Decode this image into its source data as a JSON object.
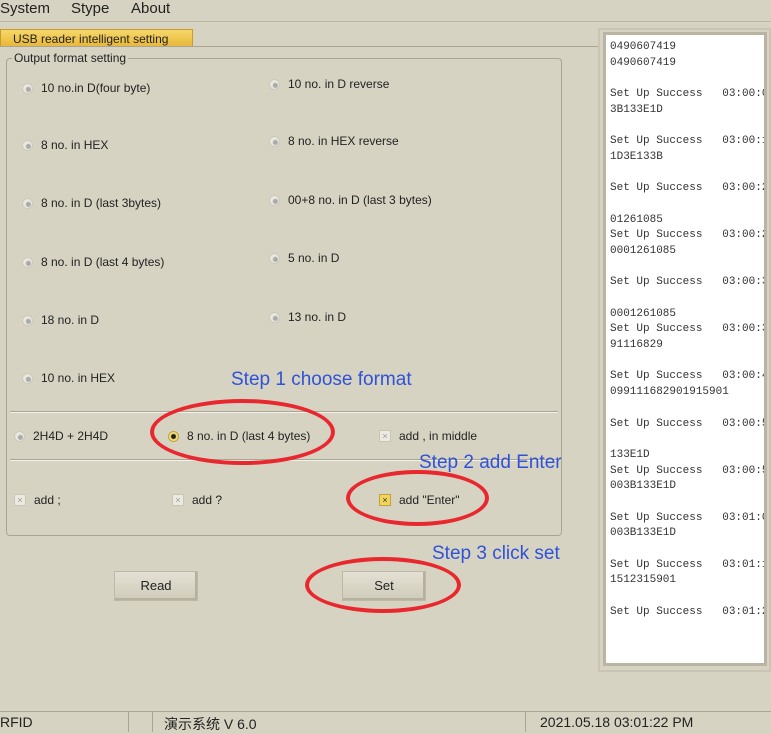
{
  "menu": {
    "system": "System",
    "stype": "Stype",
    "about": "About"
  },
  "tab": "USB reader intelligent setting",
  "group_label": "Output format setting",
  "formats": [
    "10 no.in D(four byte)",
    "10 no. in D reverse",
    "8 no. in HEX",
    "8 no. in HEX reverse",
    "8 no. in D (last 3bytes)",
    "00+8 no. in D (last 3 bytes)",
    "8 no. in D (last 4 bytes)",
    "5 no. in D",
    "18 no. in D",
    "13 no. in D",
    "10 no. in HEX"
  ],
  "row2": {
    "r1": "2H4D + 2H4D",
    "r2": "8 no. in D (last 4 bytes)",
    "r2_selected": true,
    "c1": "add , in middle"
  },
  "row3": {
    "c1": "add ;",
    "c2": "add ?",
    "c3": "add \"Enter\"",
    "c3_checked": true
  },
  "buttons": {
    "read": "Read",
    "set": "Set"
  },
  "annotations": {
    "step1": "Step 1 choose format",
    "step2": "Step 2 add Enter",
    "step3": "Step 3 click set"
  },
  "log": [
    "0490607419",
    "0490607419",
    "",
    "Set Up Success   03:00:0",
    "3B133E1D",
    "",
    "Set Up Success   03:00:1",
    "1D3E133B",
    "",
    "Set Up Success   03:00:2",
    "",
    "01261085",
    "Set Up Success   03:00:2",
    "0001261085",
    "",
    "Set Up Success   03:00:3",
    "",
    "0001261085",
    "Set Up Success   03:00:3",
    "91116829",
    "",
    "Set Up Success   03:00:4",
    "099111682901915901",
    "",
    "Set Up Success   03:00:5",
    "",
    "133E1D",
    "Set Up Success   03:00:5",
    "003B133E1D",
    "",
    "Set Up Success   03:01:0",
    "003B133E1D",
    "",
    "Set Up Success   03:01:1",
    "1512315901",
    "",
    "Set Up Success   03:01:2"
  ],
  "status": {
    "left": "RFID",
    "middle": "演示系统  V 6.0",
    "right": "2021.05.18   03:01:22 PM"
  }
}
